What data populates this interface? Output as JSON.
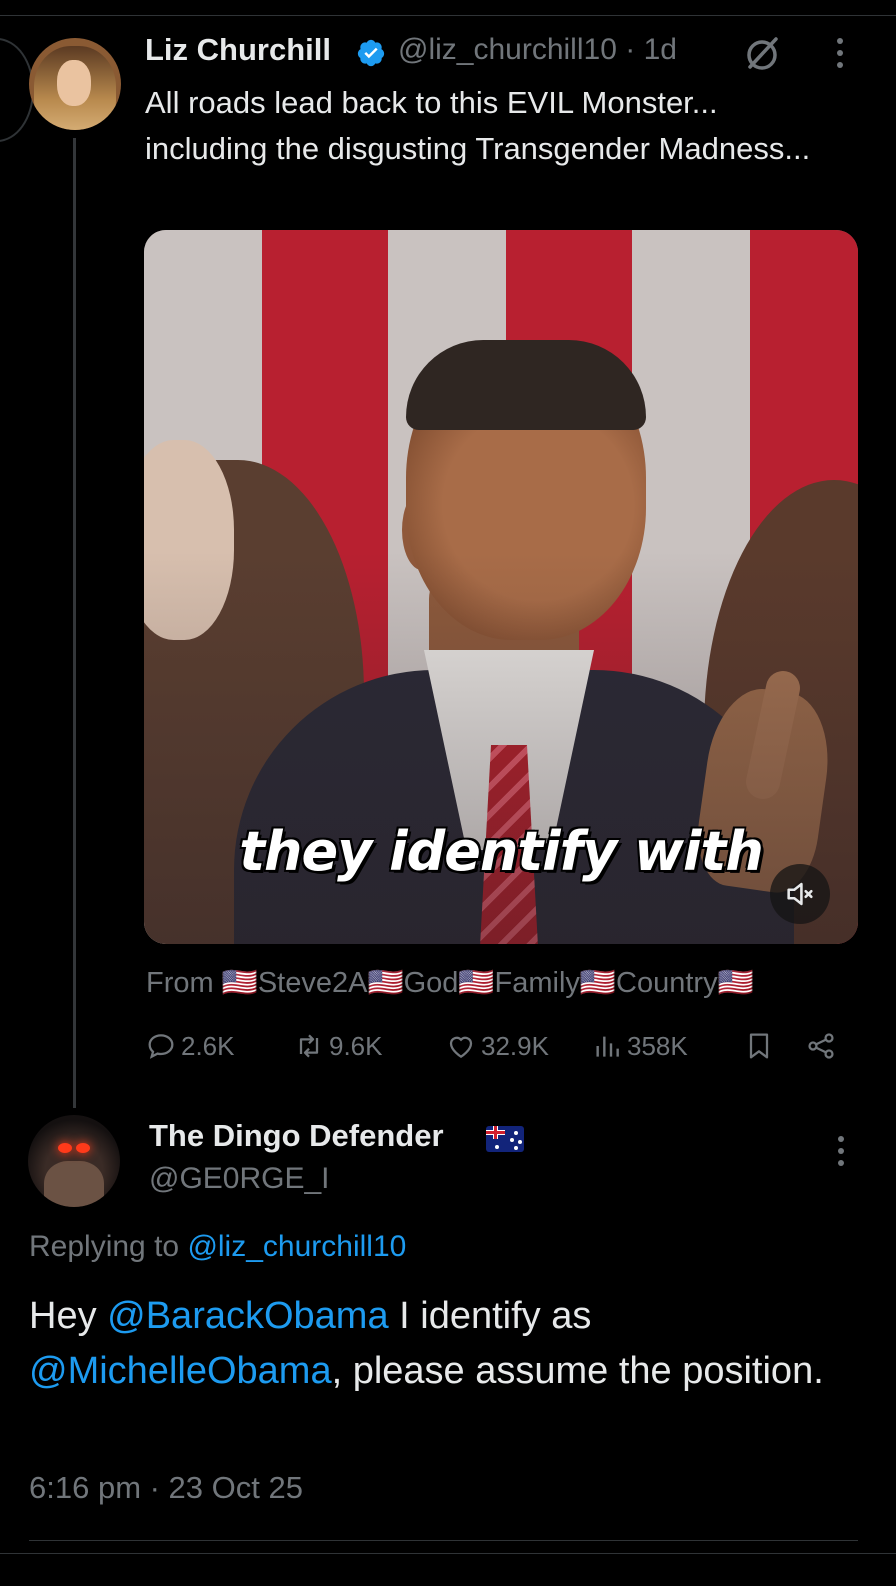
{
  "parent_tweet": {
    "author_name": "Liz Churchill",
    "handle": "@liz_churchill10",
    "separator": "·",
    "age": "1d",
    "text": "All roads lead back to this EVIL Monster... including the disgusting Transgender Madness...",
    "media": {
      "caption": "they identify with",
      "mute_icon": "volume-muted-icon"
    },
    "from_line": {
      "prefix": "From",
      "parts": [
        "Steve2A",
        "God",
        "Family",
        "Country"
      ]
    },
    "actions": {
      "replies": "2.6K",
      "reposts": "9.6K",
      "likes": "32.9K",
      "views": "358K"
    },
    "verified_color": "#1d9bf0"
  },
  "reply": {
    "author_name": "The Dingo Defender",
    "handle": "@GE0RGE_I",
    "replying_prefix": "Replying to",
    "replying_to": "@liz_churchill10",
    "text_parts": {
      "p1": "Hey ",
      "m1": "@BarackObama",
      "p2": " I identify as ",
      "m2": "@MichelleObama",
      "p3": ", please assume the position."
    },
    "timestamp": "6:16 pm · 23 Oct 25"
  },
  "colors": {
    "background": "#000000",
    "text": "#e7e9ea",
    "secondary": "#71767b",
    "link": "#1d9bf0",
    "divider": "#2f3336"
  }
}
